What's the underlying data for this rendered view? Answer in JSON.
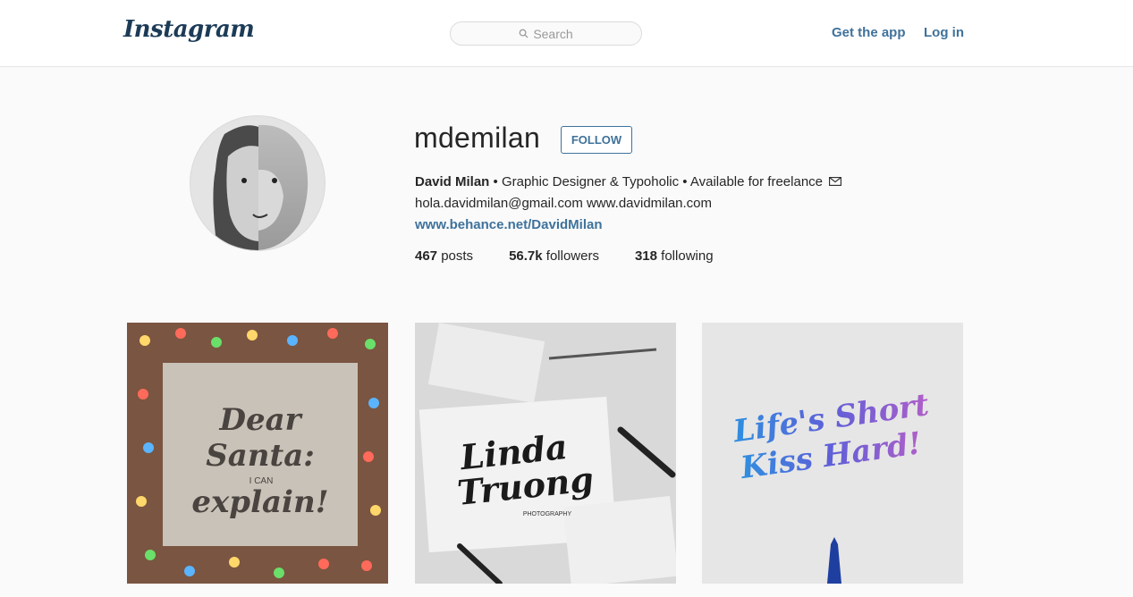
{
  "header": {
    "logo": "Instagram",
    "search_placeholder": "Search",
    "get_app": "Get the app",
    "login": "Log in"
  },
  "profile": {
    "username": "mdemilan",
    "follow_label": "FOLLOW",
    "full_name": "David Milan",
    "bio_tail": " • Graphic Designer & Typoholic • Available for freelance ",
    "contact": "hola.davidmilan@gmail.com www.davidmilan.com",
    "link": "www.behance.net/DavidMilan",
    "stats": {
      "posts_count": "467",
      "posts_label": "posts",
      "followers_count": "56.7k",
      "followers_label": "followers",
      "following_count": "318",
      "following_label": "following"
    }
  },
  "posts": [
    {
      "text1": "Dear",
      "text2": "Santa:",
      "text3": "I CAN",
      "text4": "explain!"
    },
    {
      "text1": "Linda",
      "text2": "Truong",
      "text3": "PHOTOGRAPHY"
    },
    {
      "text1": "Life's Short",
      "text2": "Kiss Hard!"
    }
  ]
}
